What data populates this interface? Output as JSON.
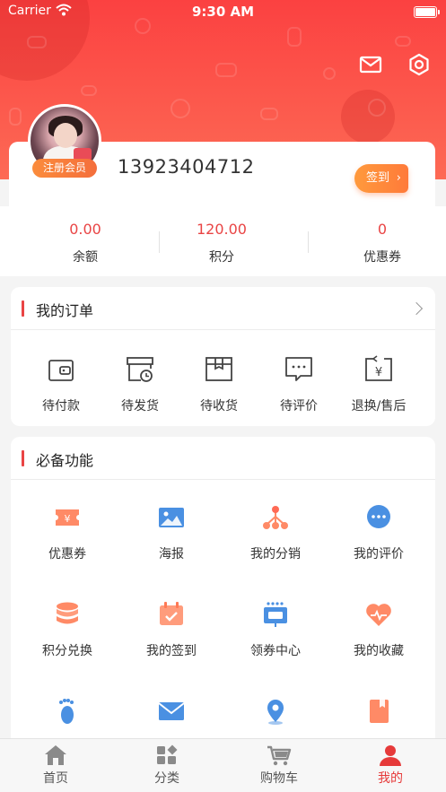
{
  "status_bar": {
    "carrier": "Carrier",
    "time": "9:30 AM"
  },
  "header": {
    "mail_icon": "mail-icon",
    "settings_icon": "settings-icon"
  },
  "profile": {
    "member_tag": "注册会员",
    "phone": "13923404712",
    "sign_in_label": "签到",
    "stats": [
      {
        "value": "0.00",
        "label": "余额"
      },
      {
        "value": "120.00",
        "label": "积分"
      },
      {
        "value": "0",
        "label": "优惠券"
      }
    ]
  },
  "orders": {
    "title": "我的订单",
    "items": [
      {
        "label": "待付款",
        "icon": "wallet-icon"
      },
      {
        "label": "待发货",
        "icon": "box-clock-icon"
      },
      {
        "label": "待收货",
        "icon": "package-icon"
      },
      {
        "label": "待评价",
        "icon": "comment-icon"
      },
      {
        "label": "退换/售后",
        "icon": "refund-icon"
      }
    ]
  },
  "features": {
    "title": "必备功能",
    "items": [
      {
        "label": "优惠券",
        "icon": "coupon-icon"
      },
      {
        "label": "海报",
        "icon": "poster-icon"
      },
      {
        "label": "我的分销",
        "icon": "distribution-icon"
      },
      {
        "label": "我的评价",
        "icon": "review-icon"
      },
      {
        "label": "积分兑换",
        "icon": "points-exchange-icon"
      },
      {
        "label": "我的签到",
        "icon": "calendar-check-icon"
      },
      {
        "label": "领券中心",
        "icon": "coupon-center-icon"
      },
      {
        "label": "我的收藏",
        "icon": "heart-icon"
      },
      {
        "label": "",
        "icon": "footprint-icon"
      },
      {
        "label": "",
        "icon": "envelope-icon"
      },
      {
        "label": "",
        "icon": "location-icon"
      },
      {
        "label": "",
        "icon": "book-icon"
      }
    ]
  },
  "tabbar": {
    "items": [
      {
        "label": "首页",
        "icon": "home-icon"
      },
      {
        "label": "分类",
        "icon": "category-icon"
      },
      {
        "label": "购物车",
        "icon": "cart-icon"
      },
      {
        "label": "我的",
        "icon": "user-icon"
      }
    ],
    "active_index": 3
  },
  "colors": {
    "primary": "#fb4141",
    "accent": "#e94444",
    "orange": "#ff8a3c",
    "blue": "#4a90e2",
    "bg": "#f4f4f4"
  }
}
